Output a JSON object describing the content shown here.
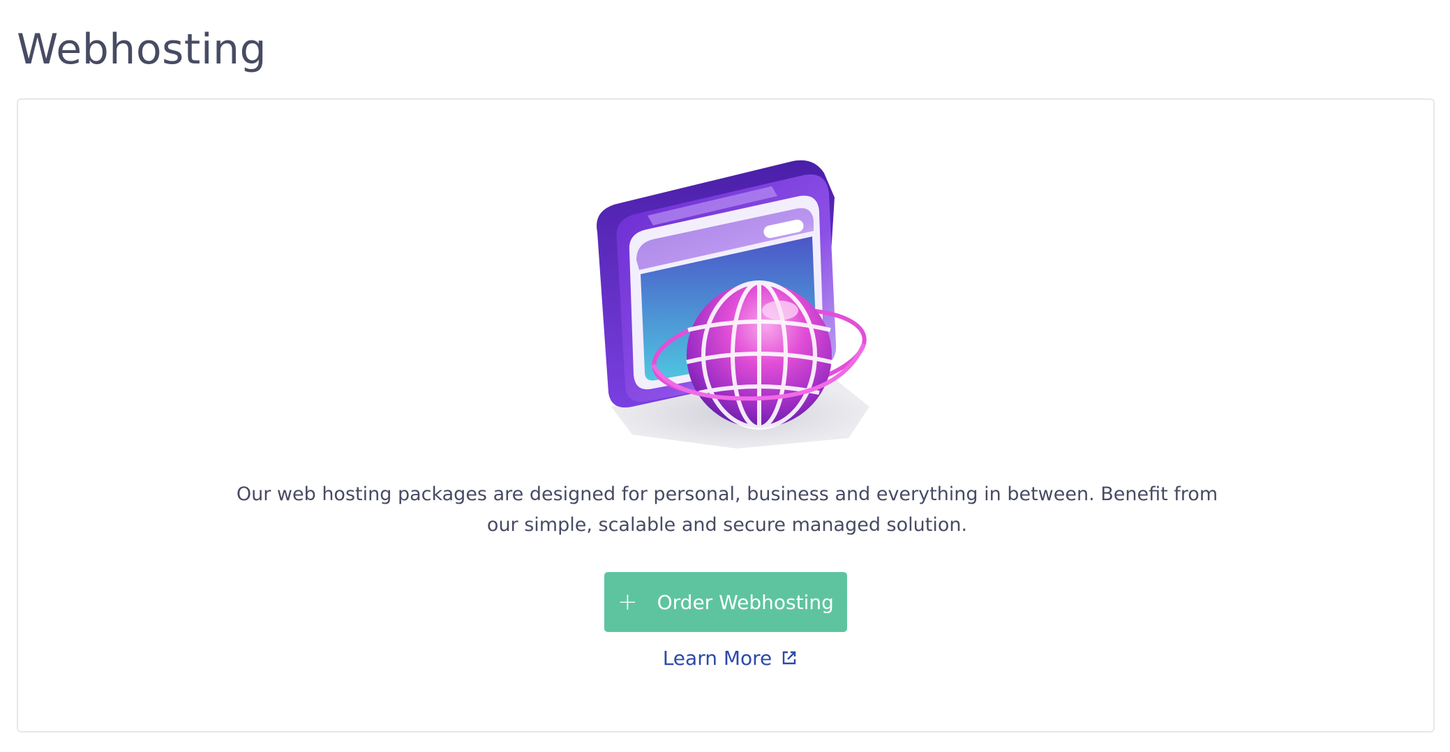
{
  "page": {
    "title": "Webhosting"
  },
  "card": {
    "illustration_icon": "globe-browser-illustration",
    "description": "Our web hosting packages are designed for personal, business and everything in between. Benefit from our simple, scalable and secure managed solution.",
    "order_button": {
      "icon": "plus-icon",
      "label": "Order Webhosting"
    },
    "learn_more": {
      "label": "Learn More",
      "icon": "external-link-icon"
    }
  },
  "colors": {
    "title_text": "#474b63",
    "primary_button": "#5ec4a0",
    "link": "#2b4aa9",
    "border": "#e5e7eb"
  }
}
